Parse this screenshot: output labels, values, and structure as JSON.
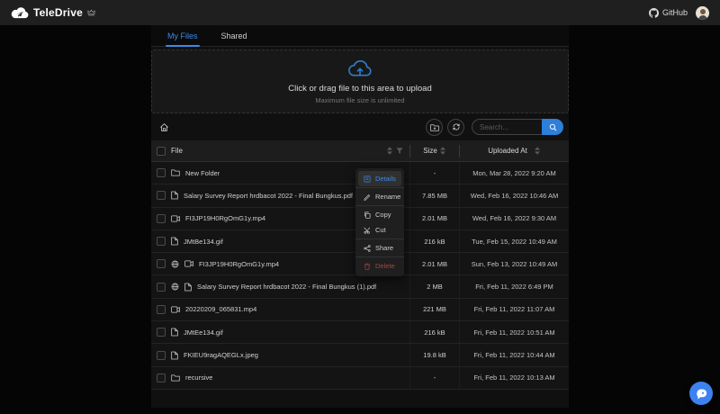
{
  "header": {
    "brand": "TeleDrive",
    "github_label": "GitHub"
  },
  "tabs": [
    {
      "label": "My Files",
      "active": true
    },
    {
      "label": "Shared",
      "active": false
    }
  ],
  "upload": {
    "title": "Click or drag file to this area to upload",
    "subtitle": "Maximum file size is unlimited"
  },
  "toolbar": {
    "search_placeholder": "Search...",
    "icons": [
      "home-icon",
      "new-folder-icon",
      "sync-icon",
      "search-icon"
    ]
  },
  "table": {
    "columns": [
      "File",
      "Size",
      "Uploaded At"
    ],
    "rows": [
      {
        "name": "New Folder",
        "icon": "folder",
        "shared": false,
        "size": "-",
        "uploaded": "Mon, Mar 28, 2022 9:20 AM"
      },
      {
        "name": "Salary Survey Report hrdbacot 2022 - Final Bungkus.pdf",
        "icon": "file",
        "shared": false,
        "size": "7.85 MB",
        "uploaded": "Wed, Feb 16, 2022 10:46 AM"
      },
      {
        "name": "FI3JP19H0RgOmG1y.mp4",
        "icon": "video",
        "shared": false,
        "size": "2.01 MB",
        "uploaded": "Wed, Feb 16, 2022 9:30 AM"
      },
      {
        "name": "JMtBe134.gif",
        "icon": "file",
        "shared": false,
        "size": "216 kB",
        "uploaded": "Tue, Feb 15, 2022 10:49 AM"
      },
      {
        "name": "FI3JP19H0RgOmG1y.mp4",
        "icon": "video",
        "shared": true,
        "size": "2.01 MB",
        "uploaded": "Sun, Feb 13, 2022 10:49 AM"
      },
      {
        "name": "Salary Survey Report hrdbacot 2022 - Final Bungkus (1).pdf",
        "icon": "file",
        "shared": true,
        "size": "2 MB",
        "uploaded": "Fri, Feb 11, 2022 6:49 PM"
      },
      {
        "name": "20220209_065831.mp4",
        "icon": "video",
        "shared": false,
        "size": "221 MB",
        "uploaded": "Fri, Feb 11, 2022 11:07 AM"
      },
      {
        "name": "JMtEe134.gif",
        "icon": "file",
        "shared": false,
        "size": "216 kB",
        "uploaded": "Fri, Feb 11, 2022 10:51 AM"
      },
      {
        "name": "FKIEU9ragAQEGLx.jpeg",
        "icon": "file",
        "shared": false,
        "size": "19.8 kB",
        "uploaded": "Fri, Feb 11, 2022 10:44 AM"
      },
      {
        "name": "recursive",
        "icon": "folder",
        "shared": false,
        "size": "-",
        "uploaded": "Fri, Feb 11, 2022 10:13 AM"
      }
    ]
  },
  "context_menu": {
    "items": [
      {
        "label": "Details",
        "icon": "info-icon",
        "active": true
      },
      {
        "label": "Rename",
        "icon": "edit-icon",
        "active": false
      },
      {
        "label": "Copy",
        "icon": "copy-icon",
        "active": false
      },
      {
        "label": "Cut",
        "icon": "scissors-icon",
        "active": false
      },
      {
        "label": "Share",
        "icon": "share-icon",
        "active": false
      },
      {
        "label": "Delete",
        "icon": "trash-icon",
        "active": false,
        "danger": true
      }
    ]
  },
  "colors": {
    "accent": "#3c89e8",
    "search-button": "#2d7fd9",
    "danger": "#a94442",
    "fab": "#3d82f0",
    "navbar-bg": "#1f1f1f"
  }
}
